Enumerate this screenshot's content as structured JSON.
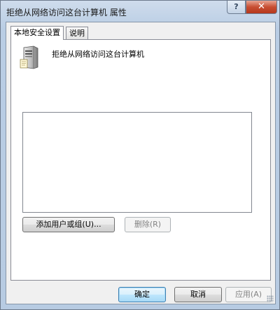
{
  "window": {
    "title": "拒绝从网络访问这台计算机 属性",
    "help_glyph": "?",
    "close_glyph": "✕"
  },
  "tabs": [
    {
      "label": "本地安全设置",
      "active": true
    },
    {
      "label": "说明",
      "active": false
    }
  ],
  "policy": {
    "icon": "server-computer-icon",
    "name": "拒绝从网络访问这台计算机"
  },
  "accounts_list": {
    "items": []
  },
  "buttons": {
    "add": "添加用户或组(U)...",
    "remove": "删除(R)",
    "ok": "确定",
    "cancel": "取消",
    "apply": "应用(A)"
  },
  "colors": {
    "close_button": "#c74e32",
    "default_button_border": "#3c7fb1",
    "window_frame": "#b9d1ea"
  }
}
